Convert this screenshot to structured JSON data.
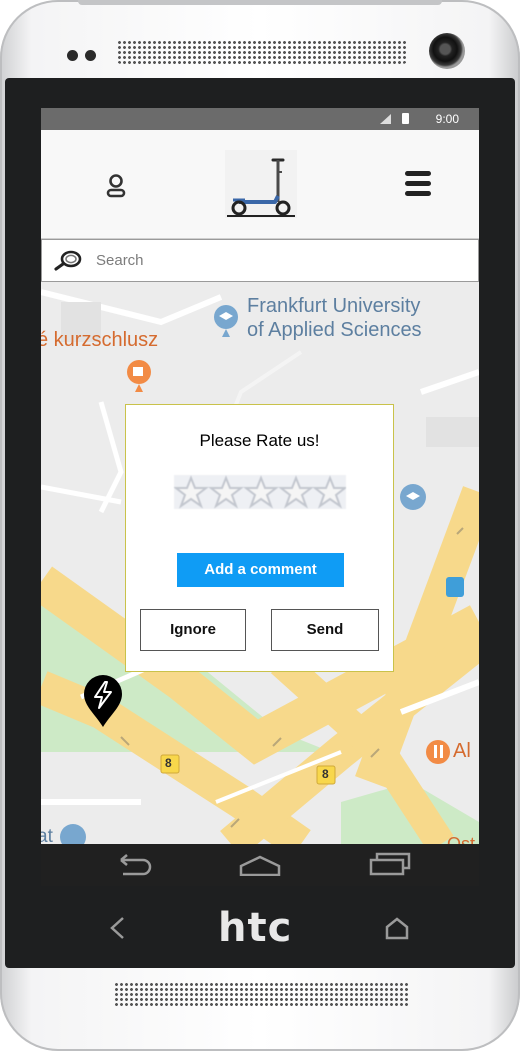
{
  "device": {
    "brand": "htc"
  },
  "status_bar": {
    "time": "9:00"
  },
  "search": {
    "placeholder": "Search"
  },
  "map": {
    "labels": {
      "university_line1": "Frankfurt University",
      "university_line2": "of Applied Sciences",
      "cafe": "é kurzschlusz",
      "restaurant": "Al",
      "road_badge_left": "8",
      "road_badge_right": "8",
      "left_edge_top": "at",
      "bottom_right": "Ost"
    },
    "markers": [
      "charging-station",
      "charging-station",
      "charging-station"
    ]
  },
  "rating_dialog": {
    "title": "Please Rate us!",
    "stars_total": 5,
    "stars_selected": 0,
    "comment_button": "Add a comment",
    "ignore_button": "Ignore",
    "send_button": "Send"
  },
  "colors": {
    "accent": "#0f9cf5",
    "road": "#f7d98b",
    "park": "#cdeac6",
    "marker": "#000000"
  }
}
